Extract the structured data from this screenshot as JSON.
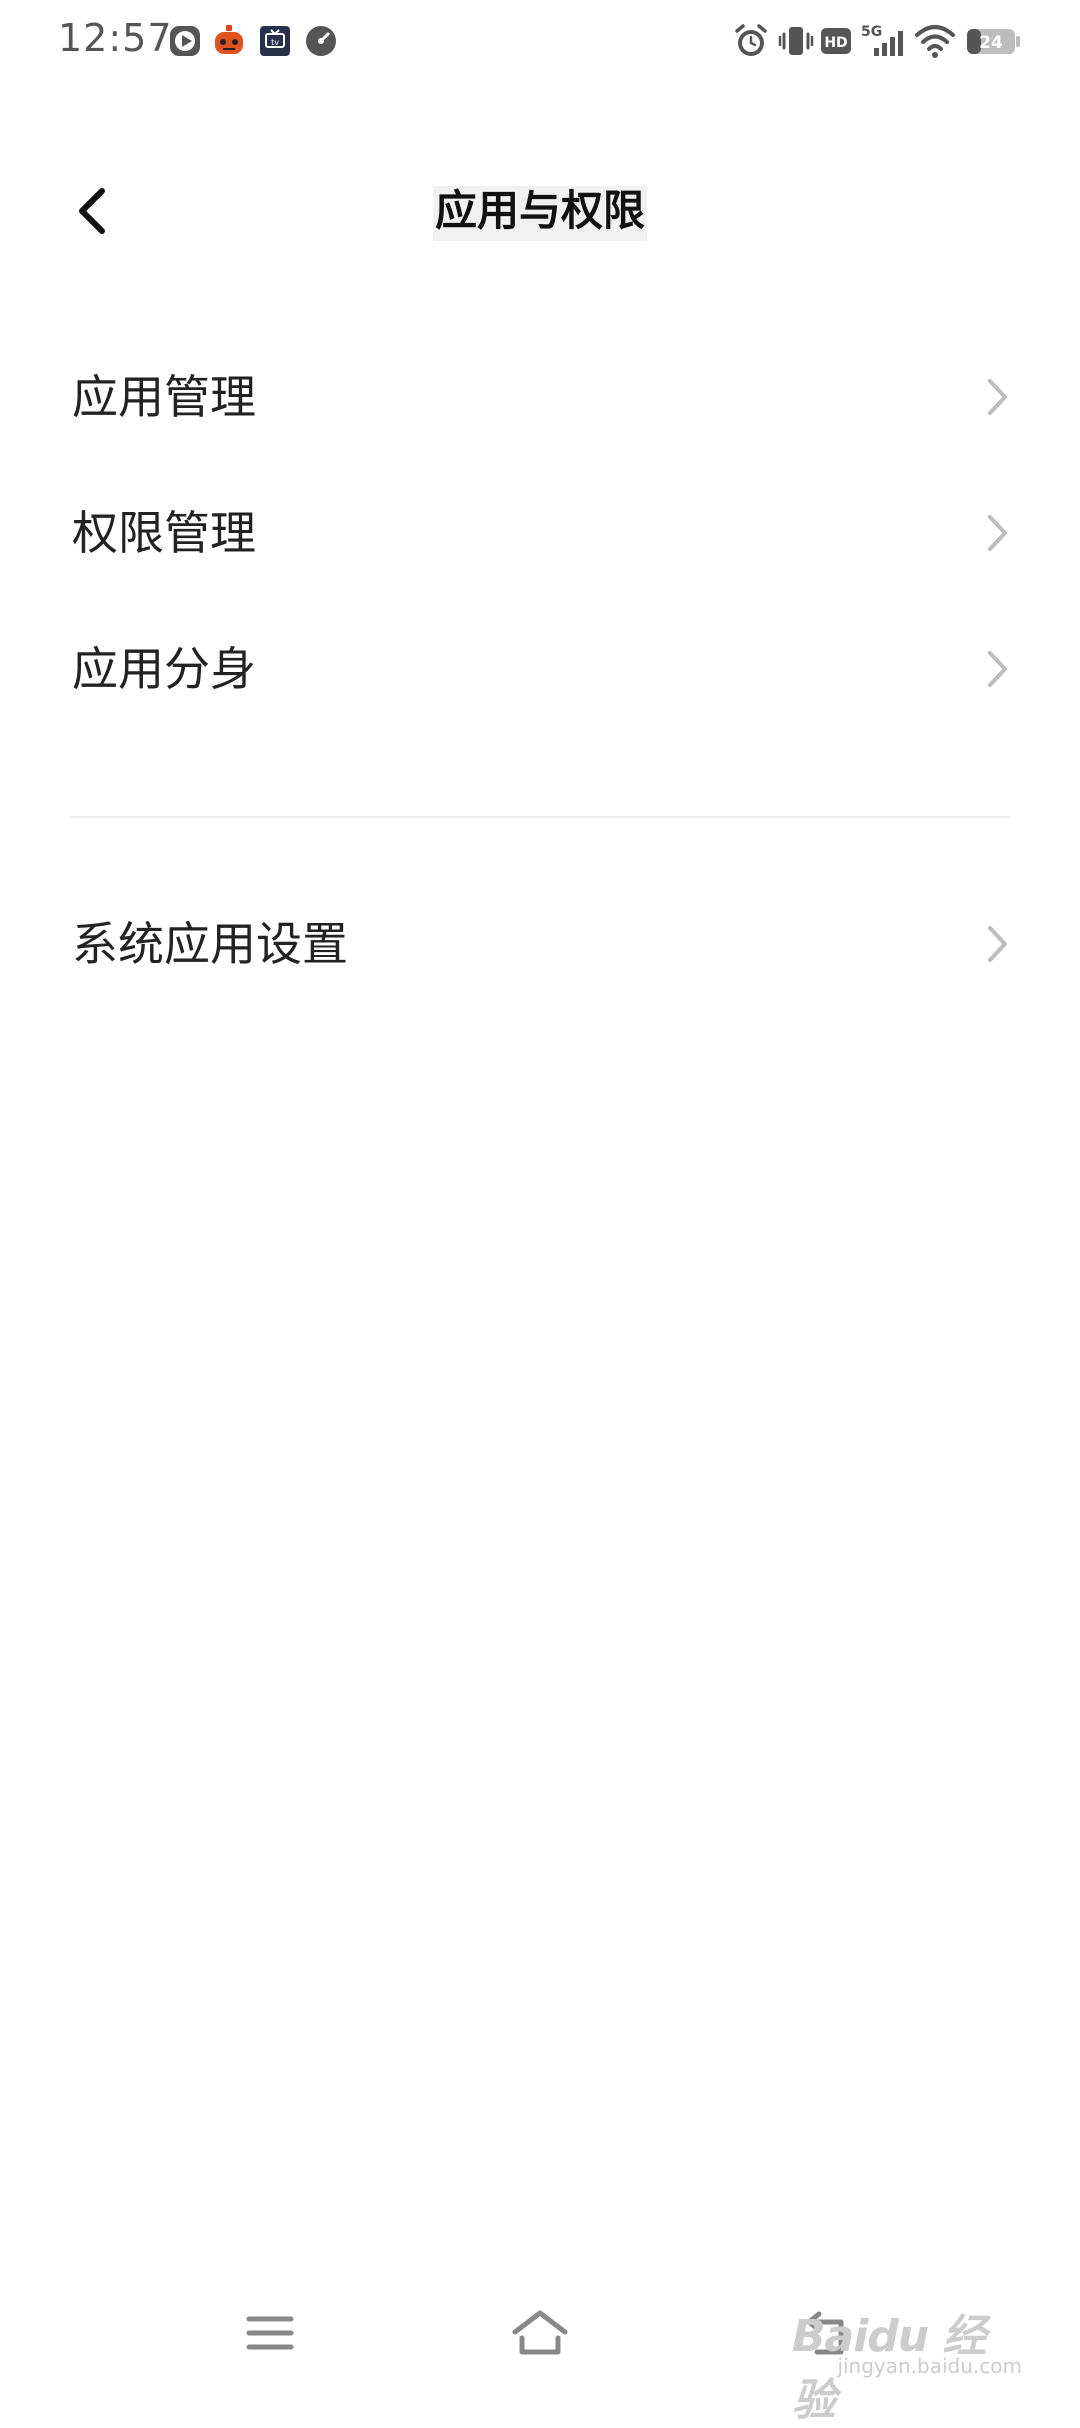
{
  "status_bar": {
    "time": "12:57",
    "network": "5G",
    "battery": "24",
    "hd_label": "HD"
  },
  "header": {
    "title": "应用与权限"
  },
  "settings_list": {
    "group1": [
      {
        "label": "应用管理"
      },
      {
        "label": "权限管理"
      },
      {
        "label": "应用分身"
      }
    ],
    "group2": [
      {
        "label": "系统应用设置"
      }
    ]
  },
  "watermark": {
    "main": "Baidu 经验",
    "sub": "jingyan.baidu.com"
  },
  "colors": {
    "text": "#222222",
    "chevron": "#bdbdbd",
    "divider": "#ececec",
    "icon": "#555555"
  }
}
